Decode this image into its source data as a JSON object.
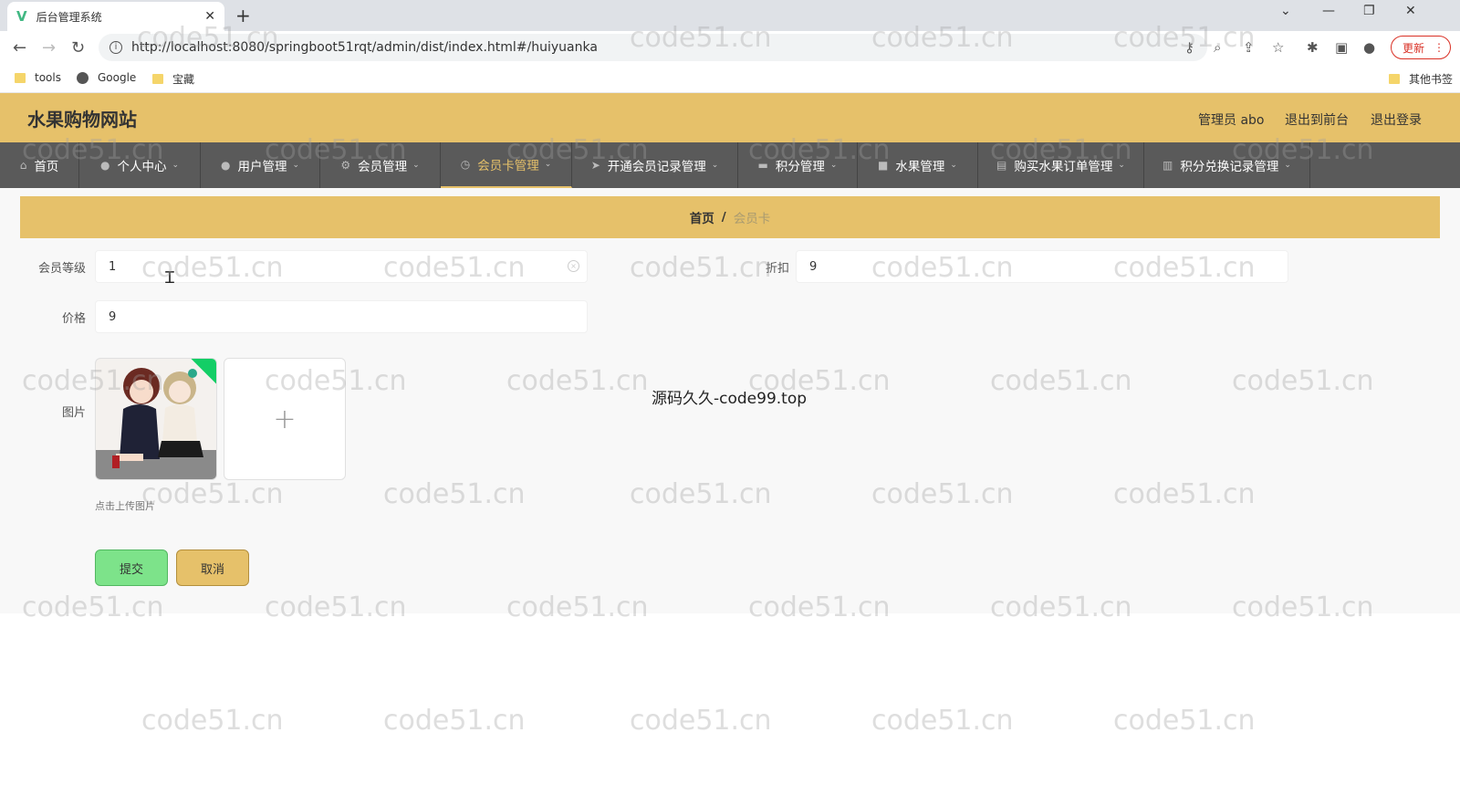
{
  "browser": {
    "tab_title": "后台管理系统",
    "tab_close": "✕",
    "new_tab": "+",
    "url": "http://localhost:8080/springboot51rqt/admin/dist/index.html#/huiyuanka",
    "update_label": "更新",
    "bookmarks": [
      "tools",
      "Google",
      "宝藏"
    ],
    "other_bookmarks": "其他书签"
  },
  "header": {
    "site_title": "水果购物网站",
    "admin_label": "管理员 abo",
    "to_front": "退出到前台",
    "logout": "退出登录"
  },
  "nav": {
    "items": [
      {
        "label": "首页",
        "icon": "home-icon",
        "has_menu": false
      },
      {
        "label": "个人中心",
        "icon": "user-icon",
        "has_menu": true
      },
      {
        "label": "用户管理",
        "icon": "pin-icon",
        "has_menu": true
      },
      {
        "label": "会员管理",
        "icon": "gear-icon",
        "has_menu": true
      },
      {
        "label": "会员卡管理",
        "icon": "clock-icon",
        "has_menu": true,
        "active": true
      },
      {
        "label": "开通会员记录管理",
        "icon": "send-icon",
        "has_menu": true
      },
      {
        "label": "积分管理",
        "icon": "chat-icon",
        "has_menu": true
      },
      {
        "label": "水果管理",
        "icon": "video-icon",
        "has_menu": true
      },
      {
        "label": "购买水果订单管理",
        "icon": "doc-icon",
        "has_menu": true
      },
      {
        "label": "积分兑换记录管理",
        "icon": "chart-icon",
        "has_menu": true
      }
    ]
  },
  "breadcrumb": {
    "home": "首页",
    "separator": "/",
    "current": "会员卡"
  },
  "form": {
    "level_label": "会员等级",
    "level_value": "1",
    "discount_label": "折扣",
    "discount_value": "9",
    "price_label": "价格",
    "price_value": "9",
    "image_label": "图片",
    "upload_tip": "点击上传图片",
    "upload_plus": "+",
    "submit": "提交",
    "cancel": "取消"
  },
  "overlay_text": "源码久久-code99.top",
  "watermark": "code51.cn",
  "colors": {
    "accent": "#e6c16a",
    "nav_bg": "#5a5a5a",
    "submit": "#7de38a",
    "success": "#13ce66"
  }
}
